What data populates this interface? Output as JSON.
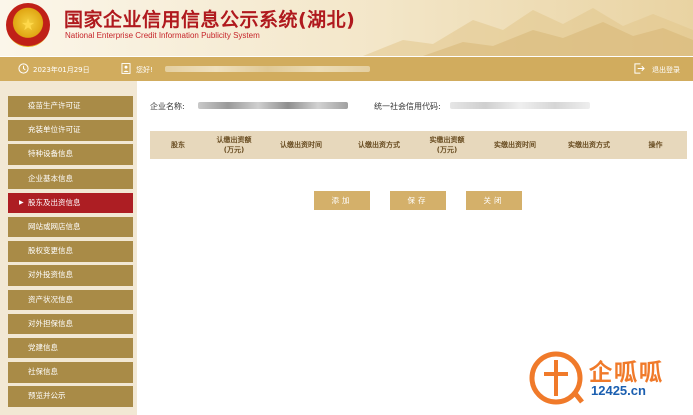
{
  "header": {
    "title_cn": "国家企业信用信息公示系统(湖北)",
    "title_en": "National Enterprise Credit Information Publicity System"
  },
  "infobar": {
    "date": "2023年01月29日",
    "greeting": "您好!",
    "logout": "退出登录"
  },
  "sidebar": {
    "items": [
      {
        "label": "疫苗生产许可证"
      },
      {
        "label": "充装单位许可证"
      },
      {
        "label": "特种设备信息"
      },
      {
        "label": "企业基本信息"
      },
      {
        "label": "股东及出资信息",
        "active": true
      },
      {
        "label": "网站或网店信息"
      },
      {
        "label": "股权变更信息"
      },
      {
        "label": "对外投资信息"
      },
      {
        "label": "资产状况信息"
      },
      {
        "label": "对外担保信息"
      },
      {
        "label": "党建信息"
      },
      {
        "label": "社保信息"
      },
      {
        "label": "预览并公示"
      }
    ]
  },
  "main": {
    "company_label": "企业名称:",
    "credit_label": "统一社会信用代码:",
    "table_headers": [
      "股东",
      "认缴出资额\n(万元)",
      "认缴出资时间",
      "认缴出资方式",
      "实缴出资额\n(万元)",
      "实缴出资时间",
      "实缴出资方式",
      "操作"
    ],
    "buttons": {
      "add": "添加",
      "save": "保存",
      "close": "关闭"
    }
  },
  "watermark": {
    "name_cn": "企呱呱",
    "site": "12425.cn"
  },
  "colors": {
    "gold": "#d1ac5e",
    "sidebar_item": "#a98b47",
    "active": "#ad1e23",
    "title_red": "#b0191e"
  }
}
